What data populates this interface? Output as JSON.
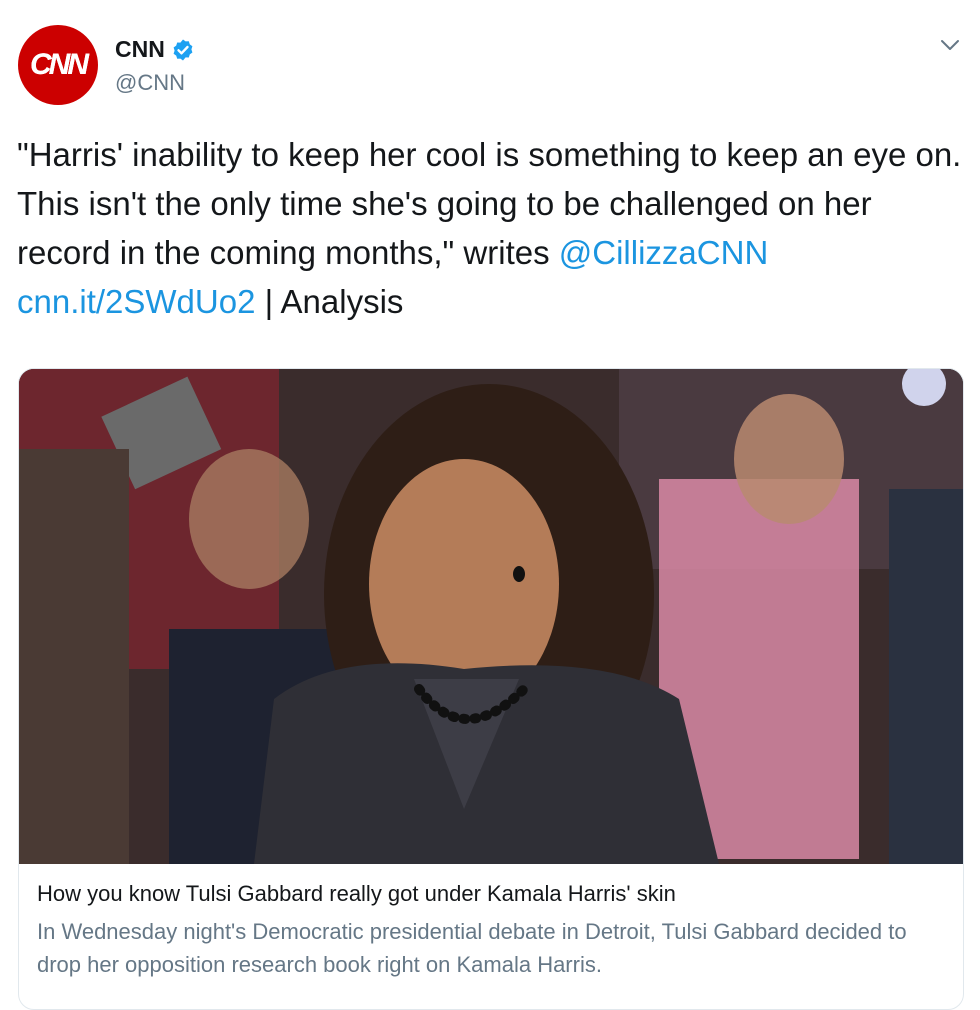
{
  "author": {
    "avatar_text": "CNN",
    "display_name": "CNN",
    "handle": "@CNN",
    "verified_icon": "verified-badge-icon",
    "menu_icon": "chevron-down-icon"
  },
  "tweet": {
    "text_part1": "\"Harris' inability to keep her cool is something to keep an eye on. This isn't the only time she's going to be challenged on her record in the coming months,\" writes ",
    "mention": "@CillizzaCNN",
    "space": " ",
    "link": "cnn.it/2SWdUo2",
    "text_part2": " | Analysis"
  },
  "card": {
    "image_alt": "Kamala Harris in a debate spin room",
    "title": "How you know Tulsi Gabbard really got under Kamala Harris' skin",
    "description": "In Wednesday night's Democratic presidential debate in Detroit, Tulsi Gabbard decided to drop her opposition research book right on Kamala Harris."
  },
  "colors": {
    "brand_red": "#cc0000",
    "link_blue": "#1b95e0",
    "secondary_text": "#657786"
  }
}
